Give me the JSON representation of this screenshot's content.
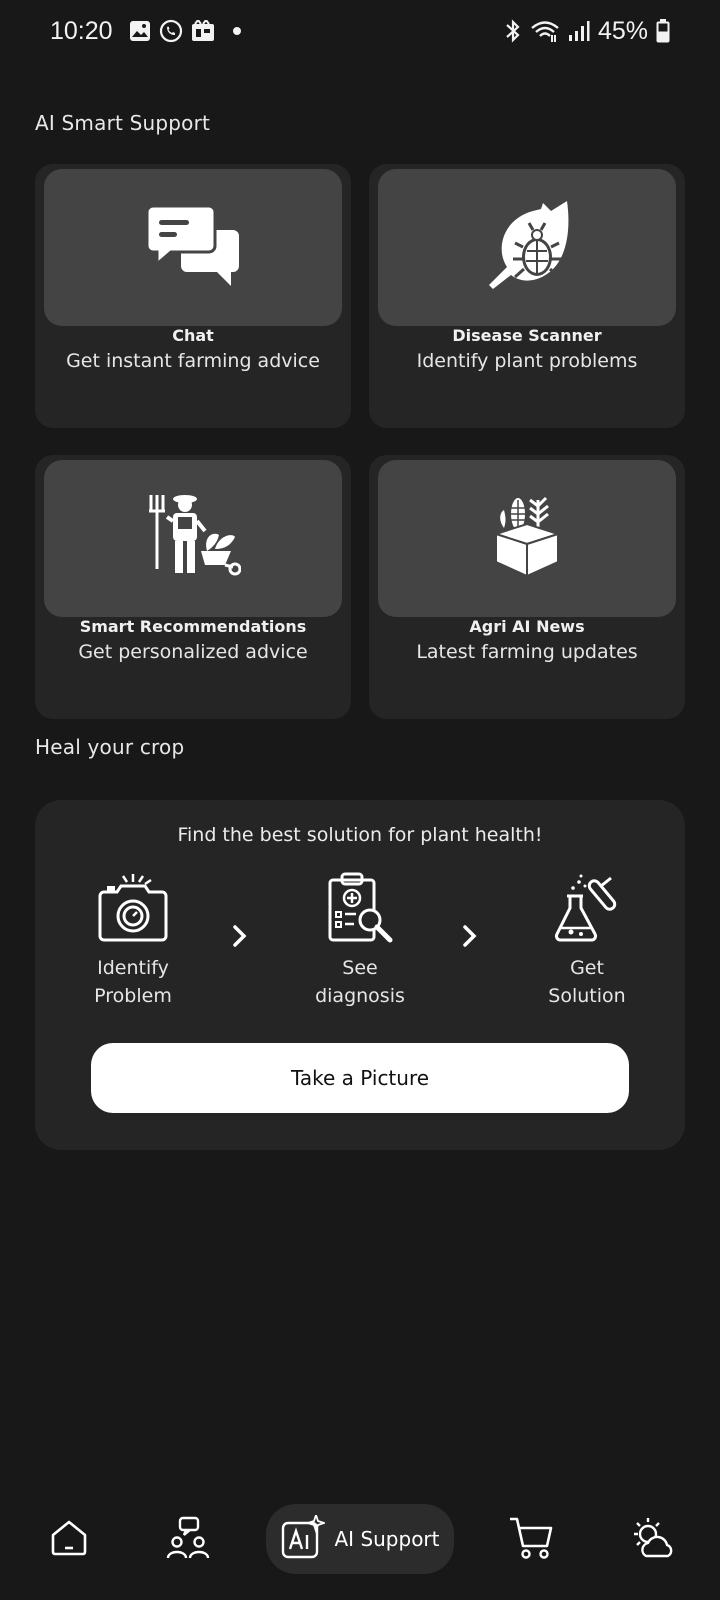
{
  "status_bar": {
    "time": "10:20",
    "battery": "45%",
    "icons": [
      "image-icon",
      "whatsapp-icon",
      "gallery-icon",
      "dot-icon",
      "bluetooth-icon",
      "wifi-icon",
      "signal-icon",
      "battery-icon"
    ]
  },
  "ai_section": {
    "title": "AI Smart Support",
    "cards": [
      {
        "title": "Chat",
        "subtitle": "Get instant farming advice",
        "icon": "chat-bubbles-icon"
      },
      {
        "title": "Disease Scanner",
        "subtitle": "Identify plant problems",
        "icon": "leaf-bug-icon"
      },
      {
        "title": "Smart Recommendations",
        "subtitle": "Get personalized advice",
        "icon": "farmer-icon"
      },
      {
        "title": "Agri AI News",
        "subtitle": "Latest farming updates",
        "icon": "crop-box-icon"
      }
    ]
  },
  "heal_section": {
    "title": "Heal your crop",
    "headline": "Find the best solution for plant health!",
    "steps": [
      {
        "line1": "Identify",
        "line2": "Problem",
        "icon": "camera-icon"
      },
      {
        "line1": "See",
        "line2": "diagnosis",
        "icon": "clipboard-diagnosis-icon"
      },
      {
        "line1": "Get",
        "line2": "Solution",
        "icon": "flask-icon"
      }
    ],
    "button_label": "Take a Picture"
  },
  "bottom_nav": {
    "items": [
      {
        "name": "home",
        "icon": "home-icon"
      },
      {
        "name": "community",
        "icon": "community-icon"
      },
      {
        "name": "ai-support",
        "icon": "ai-sparkle-icon",
        "label": "AI Support",
        "active": true
      },
      {
        "name": "cart",
        "icon": "cart-icon"
      },
      {
        "name": "weather",
        "icon": "weather-icon"
      }
    ]
  },
  "colors": {
    "background": "#181818",
    "card": "#252525",
    "card_image": "#444444",
    "button": "#ffffff"
  }
}
